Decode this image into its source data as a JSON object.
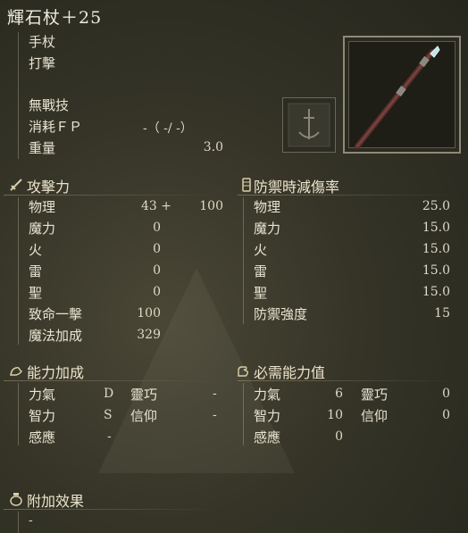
{
  "weapon": {
    "name": "輝石杖＋25",
    "type": "手杖",
    "attack_type": "打擊",
    "skill": "無戰技",
    "fp_cost": {
      "label": "消耗ＦＰ",
      "value": "-（ -/ -）"
    },
    "weight": {
      "label": "重量",
      "value": "3.0"
    }
  },
  "attack": {
    "header": "攻擊力",
    "rows": [
      {
        "label": "物理",
        "base": "43 +",
        "bonus": "100"
      },
      {
        "label": "魔力",
        "base": "0"
      },
      {
        "label": "火",
        "base": "0"
      },
      {
        "label": "雷",
        "base": "0"
      },
      {
        "label": "聖",
        "base": "0"
      },
      {
        "label": "致命一擊",
        "base": "100"
      },
      {
        "label": "魔法加成",
        "base": "329"
      }
    ]
  },
  "guard": {
    "header": "防禦時減傷率",
    "rows": [
      {
        "label": "物理",
        "value": "25.0"
      },
      {
        "label": "魔力",
        "value": "15.0"
      },
      {
        "label": "火",
        "value": "15.0"
      },
      {
        "label": "雷",
        "value": "15.0"
      },
      {
        "label": "聖",
        "value": "15.0"
      },
      {
        "label": "防禦強度",
        "value": "15"
      }
    ]
  },
  "scaling": {
    "header": "能力加成",
    "rows": [
      {
        "label": "力氣",
        "value": "D",
        "label2": "靈巧",
        "value2": "-"
      },
      {
        "label": "智力",
        "value": "S",
        "label2": "信仰",
        "value2": "-"
      },
      {
        "label": "感應",
        "value": "-"
      }
    ]
  },
  "requirements": {
    "header": "必需能力值",
    "rows": [
      {
        "label": "力氣",
        "value": "6",
        "label2": "靈巧",
        "value2": "0"
      },
      {
        "label": "智力",
        "value": "10",
        "label2": "信仰",
        "value2": "0"
      },
      {
        "label": "感應",
        "value": "0"
      }
    ]
  },
  "effects": {
    "header": "附加效果",
    "value": "-"
  },
  "icons": {
    "attack": "sword-icon",
    "guard": "shield-icon",
    "scaling": "arm-icon",
    "requirements": "hand-icon",
    "effects": "flask-icon",
    "slot": "sword-emblem-icon",
    "weapon": "staff-icon"
  }
}
